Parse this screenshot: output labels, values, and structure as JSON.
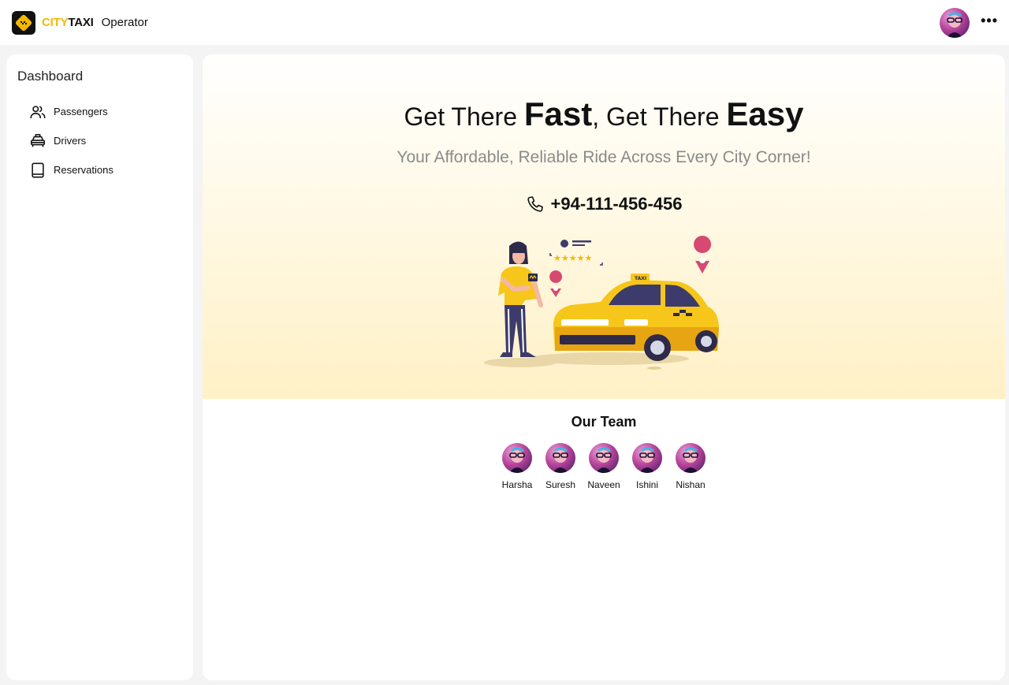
{
  "header": {
    "brand_city": "CITY",
    "brand_taxi": "TAXI",
    "role": "Operator",
    "more_label": "•••"
  },
  "sidebar": {
    "title": "Dashboard",
    "items": [
      {
        "label": "Passengers",
        "icon": "users-icon"
      },
      {
        "label": "Drivers",
        "icon": "taxi-icon"
      },
      {
        "label": "Reservations",
        "icon": "book-icon"
      }
    ]
  },
  "hero": {
    "title_part1": "Get There ",
    "title_bold1": "Fast",
    "title_part2": ", Get There ",
    "title_bold2": "Easy",
    "subtitle": "Your Affordable, Reliable Ride Across Every City Corner!",
    "phone": "+94-111-456-456"
  },
  "team": {
    "title": "Our Team",
    "members": [
      {
        "name": "Harsha"
      },
      {
        "name": "Suresh"
      },
      {
        "name": "Naveen"
      },
      {
        "name": "Ishini"
      },
      {
        "name": "Nishan"
      }
    ]
  },
  "colors": {
    "accent": "#f5b800",
    "hero_bg": "#fff1c6",
    "pin": "#d64a72"
  }
}
